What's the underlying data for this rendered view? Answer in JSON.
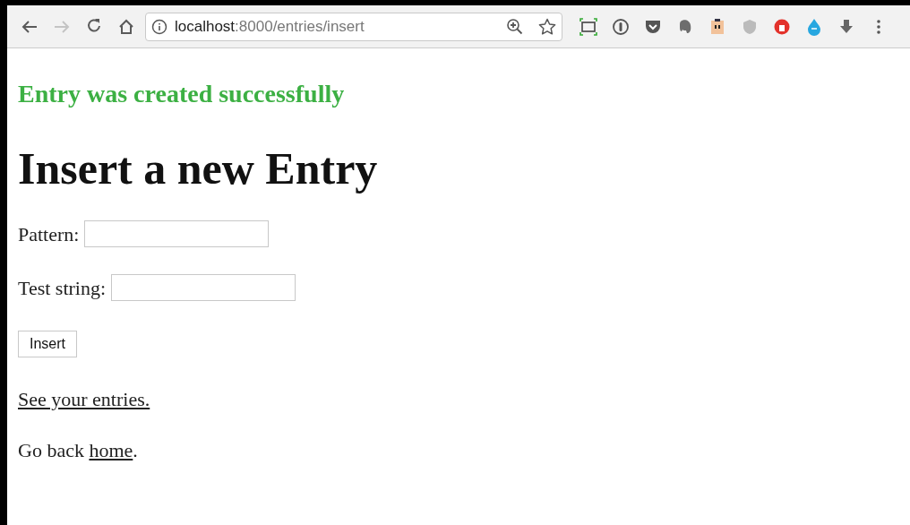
{
  "browser": {
    "back_disabled": false,
    "forward_disabled": true,
    "url": {
      "host": "localhost",
      "rest": ":8000/entries/insert"
    }
  },
  "message": "Entry was created successfully",
  "heading": "Insert a new Entry",
  "fields": [
    {
      "label": "Pattern:"
    },
    {
      "label": "Test string:"
    }
  ],
  "submit": "Insert",
  "links": [
    {
      "link": "See your entries."
    },
    {
      "before": "Go back ",
      "link": "home",
      "after": "."
    }
  ]
}
